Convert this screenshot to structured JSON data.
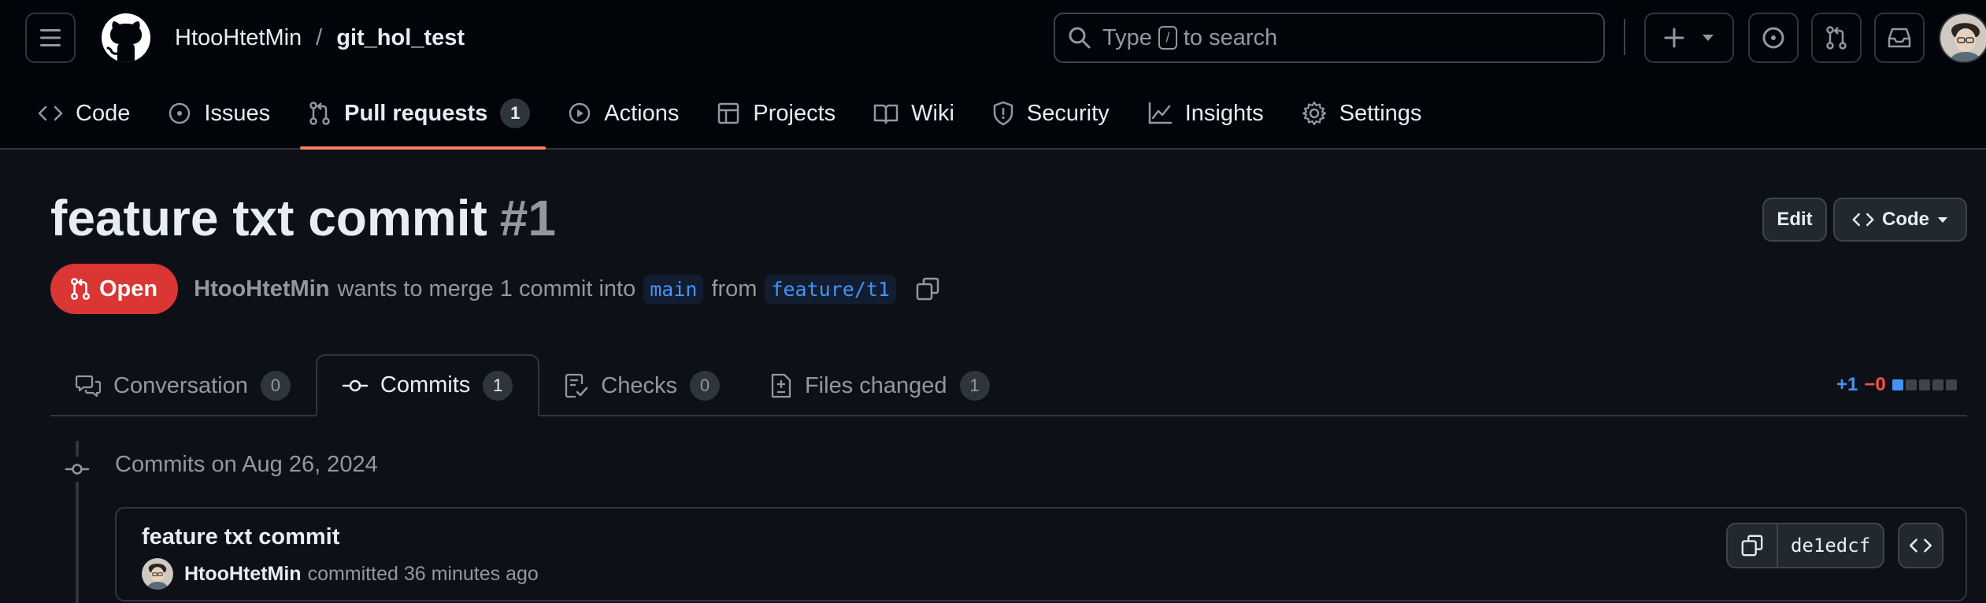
{
  "header": {
    "owner": "HtooHtetMin",
    "separator": "/",
    "repo": "git_hol_test",
    "search": {
      "prefix": "Type",
      "key": "/",
      "suffix": "to search"
    }
  },
  "repo_nav": [
    {
      "id": "code",
      "label": "Code",
      "icon": "code-icon"
    },
    {
      "id": "issues",
      "label": "Issues",
      "icon": "issue-opened-icon"
    },
    {
      "id": "pulls",
      "label": "Pull requests",
      "icon": "git-pull-request-icon",
      "count": "1",
      "active": true
    },
    {
      "id": "actions",
      "label": "Actions",
      "icon": "play-icon"
    },
    {
      "id": "projects",
      "label": "Projects",
      "icon": "table-icon"
    },
    {
      "id": "wiki",
      "label": "Wiki",
      "icon": "book-icon"
    },
    {
      "id": "security",
      "label": "Security",
      "icon": "shield-icon"
    },
    {
      "id": "insights",
      "label": "Insights",
      "icon": "graph-icon"
    },
    {
      "id": "settings",
      "label": "Settings",
      "icon": "gear-icon"
    }
  ],
  "pr": {
    "title": "feature txt commit",
    "number": "#1",
    "edit_label": "Edit",
    "code_label": "Code",
    "state": "Open",
    "author": "HtooHtetMin",
    "summary": "wants to merge 1 commit into",
    "base_branch": "main",
    "from_word": "from",
    "head_branch": "feature/t1"
  },
  "tabs": [
    {
      "id": "conversation",
      "label": "Conversation",
      "count": "0",
      "icon": "comment-discussion-icon"
    },
    {
      "id": "commits",
      "label": "Commits",
      "count": "1",
      "icon": "git-commit-icon",
      "selected": true
    },
    {
      "id": "checks",
      "label": "Checks",
      "count": "0",
      "icon": "checklist-icon"
    },
    {
      "id": "files",
      "label": "Files changed",
      "count": "1",
      "icon": "file-diff-icon"
    }
  ],
  "diffstat": {
    "additions": "+1",
    "deletions": "−0",
    "blocks_added": 1,
    "blocks_total": 5
  },
  "commits": {
    "date_heading": "Commits on Aug 26, 2024",
    "items": [
      {
        "message": "feature txt commit",
        "author": "HtooHtetMin",
        "action": "committed",
        "time": "36 minutes ago",
        "sha": "de1edcf"
      }
    ]
  },
  "colors": {
    "bg": "#0d1117",
    "header_bg": "#010409",
    "border": "#30363d",
    "accent_underline": "#f78166",
    "open_state": "#da3633",
    "link_blue": "#4493f8",
    "deletions_red": "#f85149"
  }
}
